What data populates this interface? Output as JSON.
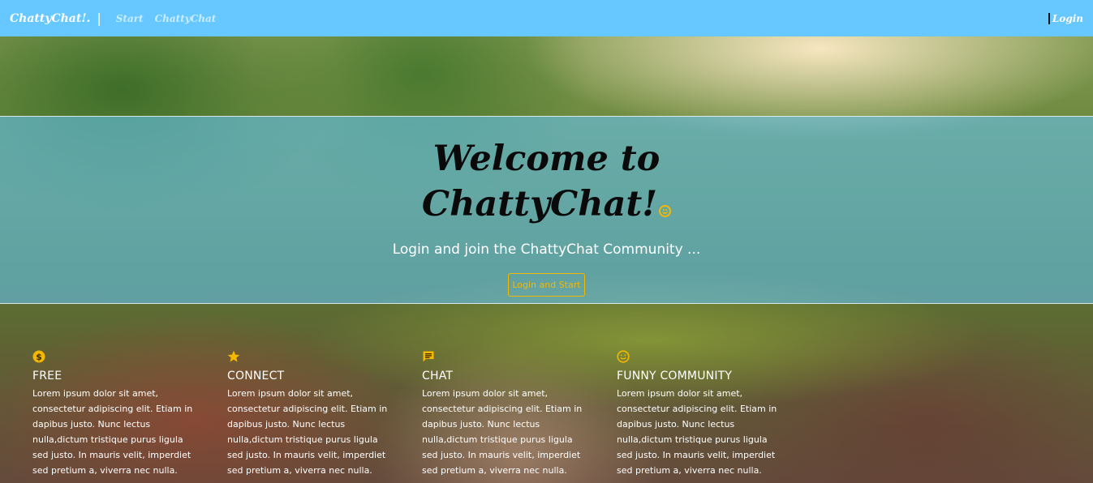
{
  "navbar": {
    "brand": "ChattyChat!.",
    "separator": "|",
    "links": [
      "Start",
      "ChattyChat"
    ],
    "login_label": "Login"
  },
  "hero": {
    "title_line1": "Welcome to",
    "title_line2": "ChattyChat!",
    "subtitle": "Login and join the ChattyChat Community ...",
    "button_label": "Login and Start"
  },
  "features": [
    {
      "icon": "dollar-icon",
      "title": "FREE",
      "text": "Lorem ipsum dolor sit amet, consectetur adipiscing elit. Etiam in dapibus justo. Nunc lectus nulla,dictum tristique purus ligula sed justo. In mauris velit, imperdiet sed pretium a, viverra nec nulla."
    },
    {
      "icon": "star-icon",
      "title": "CONNECT",
      "text": "Lorem ipsum dolor sit amet, consectetur adipiscing elit. Etiam in dapibus justo. Nunc lectus nulla,dictum tristique purus ligula sed justo. In mauris velit, imperdiet sed pretium a, viverra nec nulla."
    },
    {
      "icon": "chat-icon",
      "title": "CHAT",
      "text": "Lorem ipsum dolor sit amet, consectetur adipiscing elit. Etiam in dapibus justo. Nunc lectus nulla,dictum tristique purus ligula sed justo. In mauris velit, imperdiet sed pretium a, viverra nec nulla."
    },
    {
      "icon": "smiley-icon",
      "title": "FUNNY COMMUNITY",
      "text": "Lorem ipsum dolor sit amet, consectetur adipiscing elit. Etiam in dapibus justo. Nunc lectus nulla,dictum tristique purus ligula sed justo. In mauris velit, imperdiet sed pretium a, viverra nec nulla."
    }
  ],
  "colors": {
    "navbar": "#66c8ff",
    "accent": "#f5b800",
    "hero_overlay": "#66c8ff"
  }
}
